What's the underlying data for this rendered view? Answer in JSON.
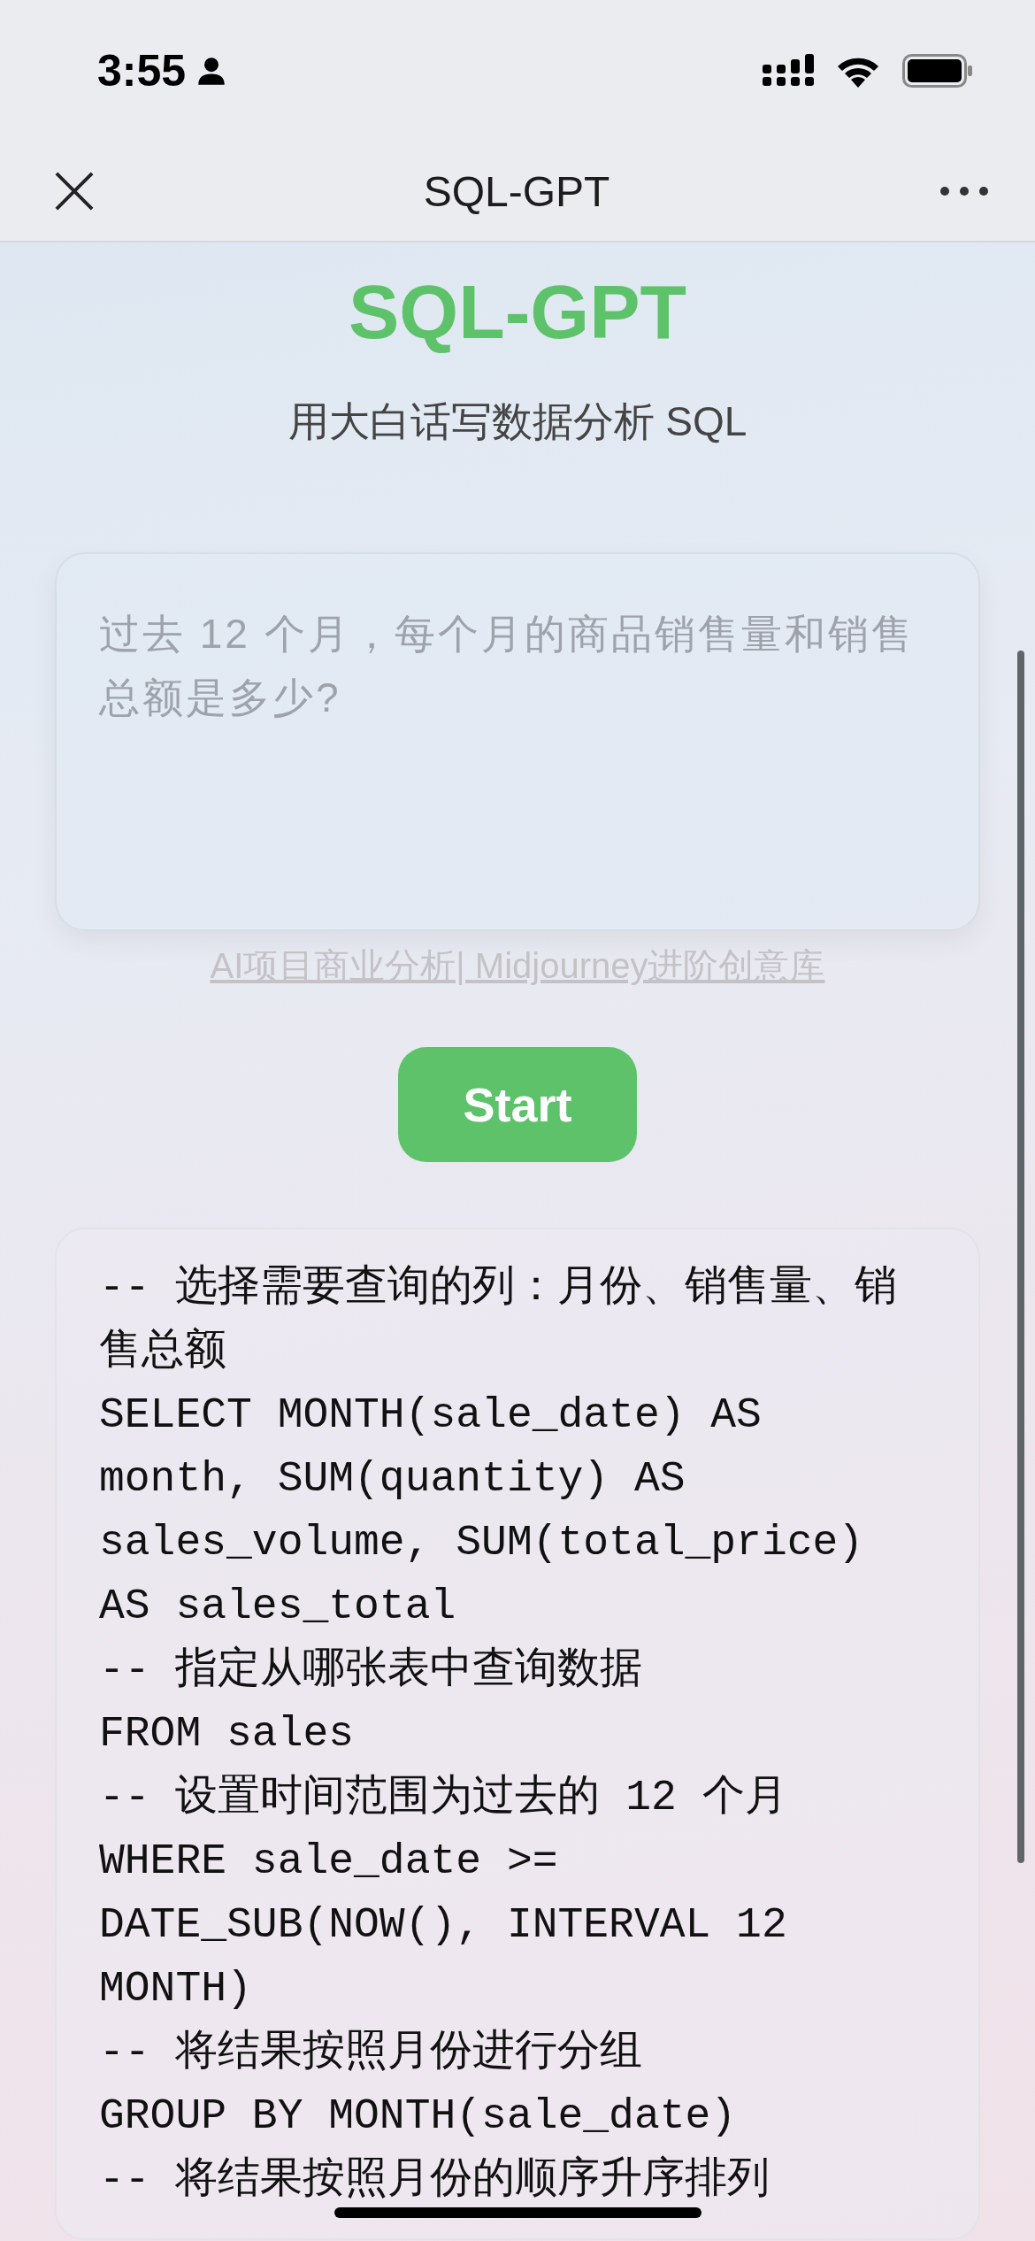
{
  "status_bar": {
    "time": "3:55"
  },
  "nav": {
    "title": "SQL-GPT"
  },
  "header": {
    "title": "SQL-GPT",
    "subtitle": "用大白话写数据分析 SQL"
  },
  "query": {
    "placeholder": "过去 12 个月，每个月的商品销售量和销售总额是多少?"
  },
  "link": {
    "text": "AI项目商业分析| Midjourney进阶创意库"
  },
  "start_button": {
    "label": "Start"
  },
  "result": {
    "lines": [
      "-- 选择需要查询的列：月份、销售量、销售总额",
      "SELECT MONTH(sale_date) AS month, SUM(quantity) AS sales_volume, SUM(total_price) AS sales_total",
      "-- 指定从哪张表中查询数据",
      "FROM sales",
      "-- 设置时间范围为过去的 12 个月",
      "WHERE sale_date >= DATE_SUB(NOW(), INTERVAL 12 MONTH)",
      "-- 将结果按照月份进行分组",
      "GROUP BY MONTH(sale_date)",
      "-- 将结果按照月份的顺序升序排列"
    ]
  }
}
